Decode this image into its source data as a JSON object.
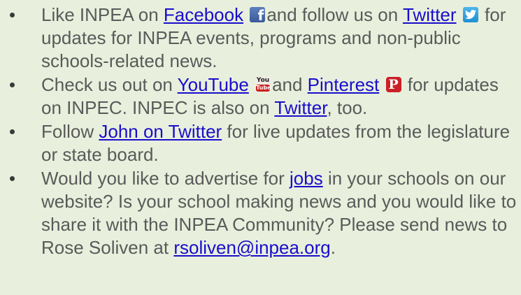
{
  "items": [
    {
      "t1": "Like INPEA on ",
      "l1": "Facebook",
      "fb_letter": "f",
      "t2": "and follow us on ",
      "l2": "Twitter",
      "t3": " for updates for INPEA events, programs and non-public schools-related news."
    },
    {
      "t1": "Check us out on ",
      "l1": "YouTube",
      "yt_you": "You",
      "yt_tube": "Tube",
      "t2": "and ",
      "l2": "Pinterest",
      "pin_letter": "P",
      "t3": " for updates on INPEC. INPEC is also on ",
      "l3": "Twitter",
      "t4": ", too."
    },
    {
      "t1": "Follow ",
      "l1": "John on Twitter",
      "t2": " for live updates from the legislature or state board."
    },
    {
      "t1": "Would you like to advertise for ",
      "l1": "jobs",
      "t2": " in your schools on our website? Is your school making news and you would like to share it with the INPEA Community? Please send news to Rose Soliven at ",
      "l2": "rsoliven@inpea.org",
      "t3": "."
    }
  ],
  "icons": {
    "facebook": "facebook-icon",
    "twitter": "twitter-icon",
    "youtube": "youtube-icon",
    "pinterest": "pinterest-icon"
  },
  "colors": {
    "background": "#e8f0dd",
    "text": "#5a5a5a",
    "link": "#1a0dcc",
    "facebook": "#3b5a98",
    "twitter": "#1e8fd0",
    "youtube": "#c8201e",
    "pinterest": "#cb2027"
  }
}
